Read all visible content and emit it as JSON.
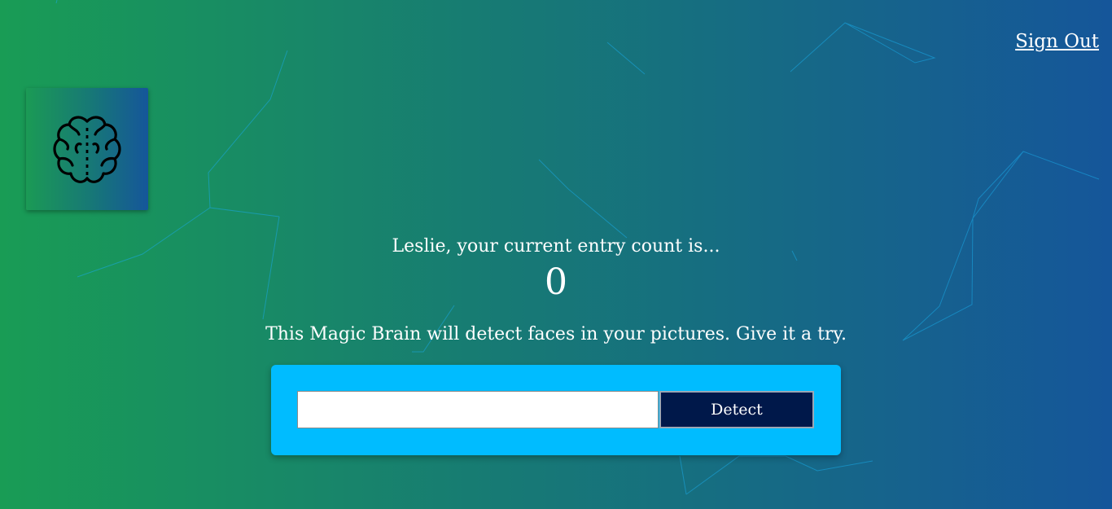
{
  "nav": {
    "sign_out_label": "Sign Out"
  },
  "logo": {
    "icon": "brain-icon"
  },
  "rank": {
    "greeting": "Leslie, your current entry count is...",
    "entry_count": "0"
  },
  "intro": {
    "tagline": "This Magic Brain will detect faces in your pictures. Give it a try."
  },
  "image_link_form": {
    "input_value": "",
    "input_placeholder": "",
    "detect_label": "Detect"
  },
  "colors": {
    "gradient_start": "#199c55",
    "gradient_end": "#15569a",
    "form_pattern": "#00bcff",
    "detect_button_bg": "#00184a",
    "particle_line": "#00b4ff"
  }
}
